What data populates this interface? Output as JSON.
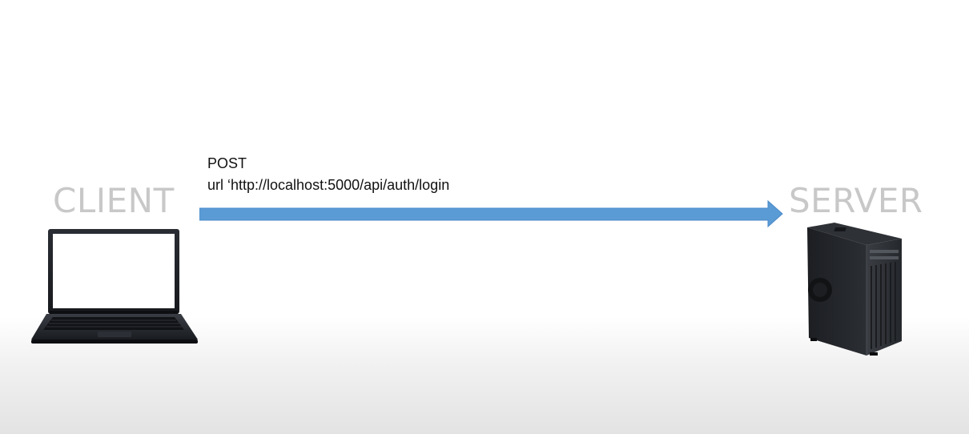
{
  "diagram": {
    "client": {
      "label": "CLIENT",
      "icon": "laptop-icon"
    },
    "server": {
      "label": "SERVER",
      "icon": "server-tower-icon"
    },
    "request": {
      "method": "POST",
      "url_line": "url ‘http://localhost:5000/api/auth/login",
      "direction": "client-to-server",
      "arrow_color": "#5b9bd5"
    }
  }
}
